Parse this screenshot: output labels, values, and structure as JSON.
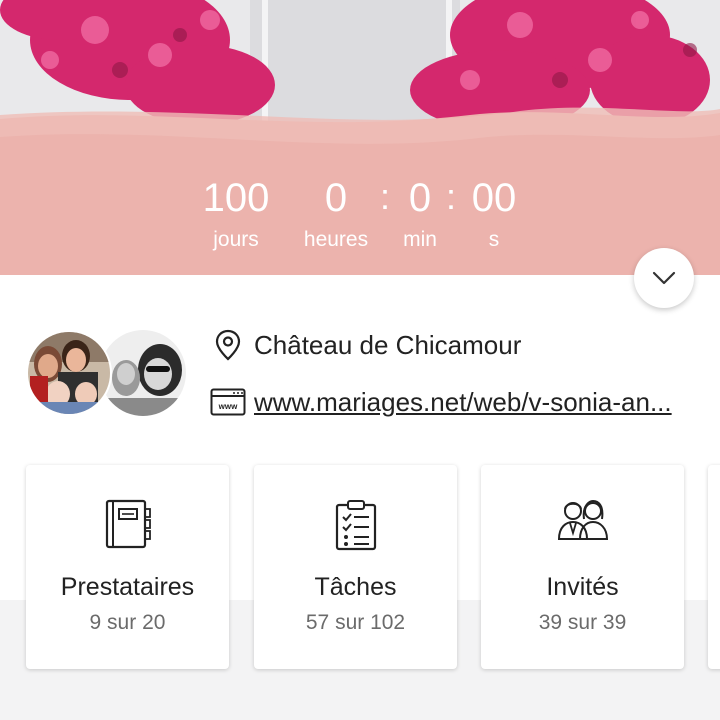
{
  "countdown": {
    "days": "100",
    "days_label": "jours",
    "hours": "0",
    "hours_label": "heures",
    "sep1": ":",
    "minutes": "0",
    "minutes_label": "min",
    "sep2": ":",
    "seconds": "00",
    "seconds_label": "s"
  },
  "profile": {
    "location": "Château de Chicamour",
    "website": "www.mariages.net/web/v-sonia-an...",
    "website_icon_text": "www"
  },
  "cards": [
    {
      "title": "Prestataires",
      "count": "9 sur 20",
      "icon": "notebook-icon"
    },
    {
      "title": "Tâches",
      "count": "57 sur 102",
      "icon": "checklist-icon"
    },
    {
      "title": "Invités",
      "count": "39 sur 39",
      "icon": "guests-icon"
    }
  ],
  "colors": {
    "band_pink": "#ecb3ad",
    "flowers": "#d4286d",
    "text": "#222222",
    "muted": "#6b6b6b"
  }
}
